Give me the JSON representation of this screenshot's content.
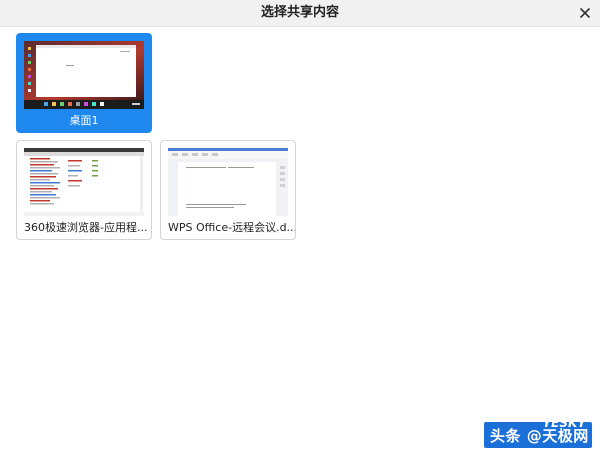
{
  "window": {
    "title": "选择共享内容",
    "close_icon": "close-icon"
  },
  "sources": [
    {
      "label": "桌面1",
      "selected": true,
      "thumb": "desktop-thumbnail"
    },
    {
      "label": "360极速浏览器-应用程...",
      "selected": false,
      "thumb": "browser-thumbnail"
    },
    {
      "label": "WPS Office-远程会议.d...",
      "selected": false,
      "thumb": "document-thumbnail"
    }
  ],
  "watermark": {
    "text": "头条 @天极网",
    "brand": "YESKY"
  },
  "colors": {
    "accent": "#1e88ef",
    "titlebar": "#f1f1f1"
  }
}
